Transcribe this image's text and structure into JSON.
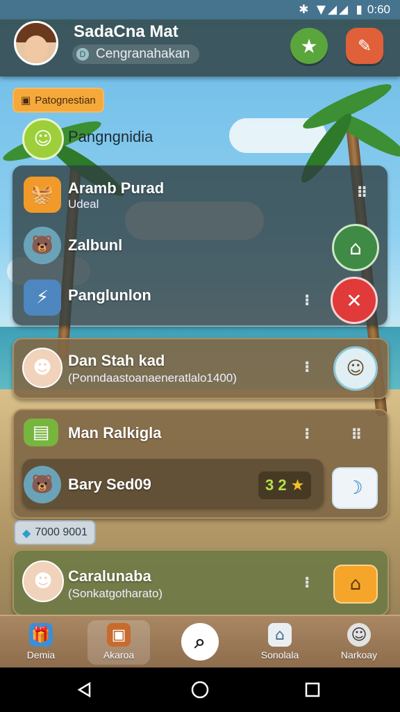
{
  "status": {
    "icons": "✱ ▼◢◢ ▮",
    "time": "0:60"
  },
  "header": {
    "user_name": "SadaCna Mat",
    "user_sub": "Cengranahakan",
    "user_sub_icon": "D",
    "star_icon": "star-icon",
    "edit_icon": "edit-icon",
    "star_color": "#5aa63c",
    "edit_color": "#e0603a"
  },
  "section_chip": {
    "label": "Patognestian",
    "icon": "box-icon"
  },
  "group_title": "Pangngnidia",
  "rows": {
    "r1": {
      "title": "Aramb Purad",
      "sub": "Udeal"
    },
    "r2": {
      "title": "Zalbunl"
    },
    "r3": {
      "title": "Panglunlon"
    },
    "r4": {
      "title": "Dan Stah kad",
      "sub": "(Ponndaastoanaeneratlalo1400)"
    },
    "r5": {
      "title": "Man Ralkigla"
    },
    "r6": {
      "title": "Bary Sed09",
      "score": "3 2"
    },
    "r7": {
      "title": "Caralunaba",
      "sub": "(Sonkatgotharato)"
    }
  },
  "mid_chip": {
    "label": "7000 9001"
  },
  "bottom_nav": {
    "items": [
      {
        "label": "Demia",
        "icon": "gift-icon"
      },
      {
        "label": "Akaroa",
        "icon": "bag-icon"
      },
      {
        "label": "",
        "icon": "search-icon"
      },
      {
        "label": "Sonolala",
        "icon": "home-icon"
      },
      {
        "label": "Narkoay",
        "icon": "face-icon"
      }
    ]
  },
  "system_nav": {
    "back": "back-icon",
    "home": "home-circle-icon",
    "recents": "recents-icon"
  }
}
